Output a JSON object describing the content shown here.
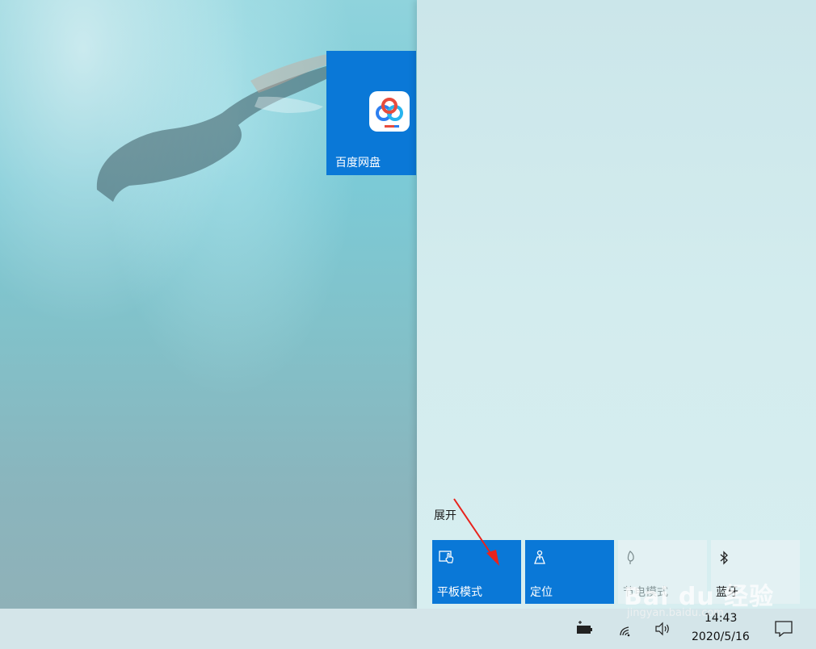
{
  "desktop": {
    "start_tiles": [
      {
        "label": "百度网盘",
        "icon": "baidu-netdisk-icon",
        "bg": "#0a78d7"
      }
    ]
  },
  "action_center": {
    "expand_label": "展开",
    "quick_actions": [
      {
        "label": "平板模式",
        "icon": "tablet-mode-icon",
        "state": "on"
      },
      {
        "label": "定位",
        "icon": "location-icon",
        "state": "on"
      },
      {
        "label": "节电模式",
        "icon": "battery-saver-icon",
        "state": "off"
      },
      {
        "label": "蓝牙",
        "icon": "bluetooth-icon",
        "state": "off"
      }
    ],
    "accent": "#0a78d7"
  },
  "taskbar": {
    "tray_icons": [
      "power-icon",
      "wifi-icon",
      "volume-icon"
    ],
    "time": "14:43",
    "date": "2020/5/16",
    "notification_icon": "notification-icon"
  },
  "watermark": {
    "logo": "Bai du 经验",
    "url": "jingyan.baidu.com"
  }
}
